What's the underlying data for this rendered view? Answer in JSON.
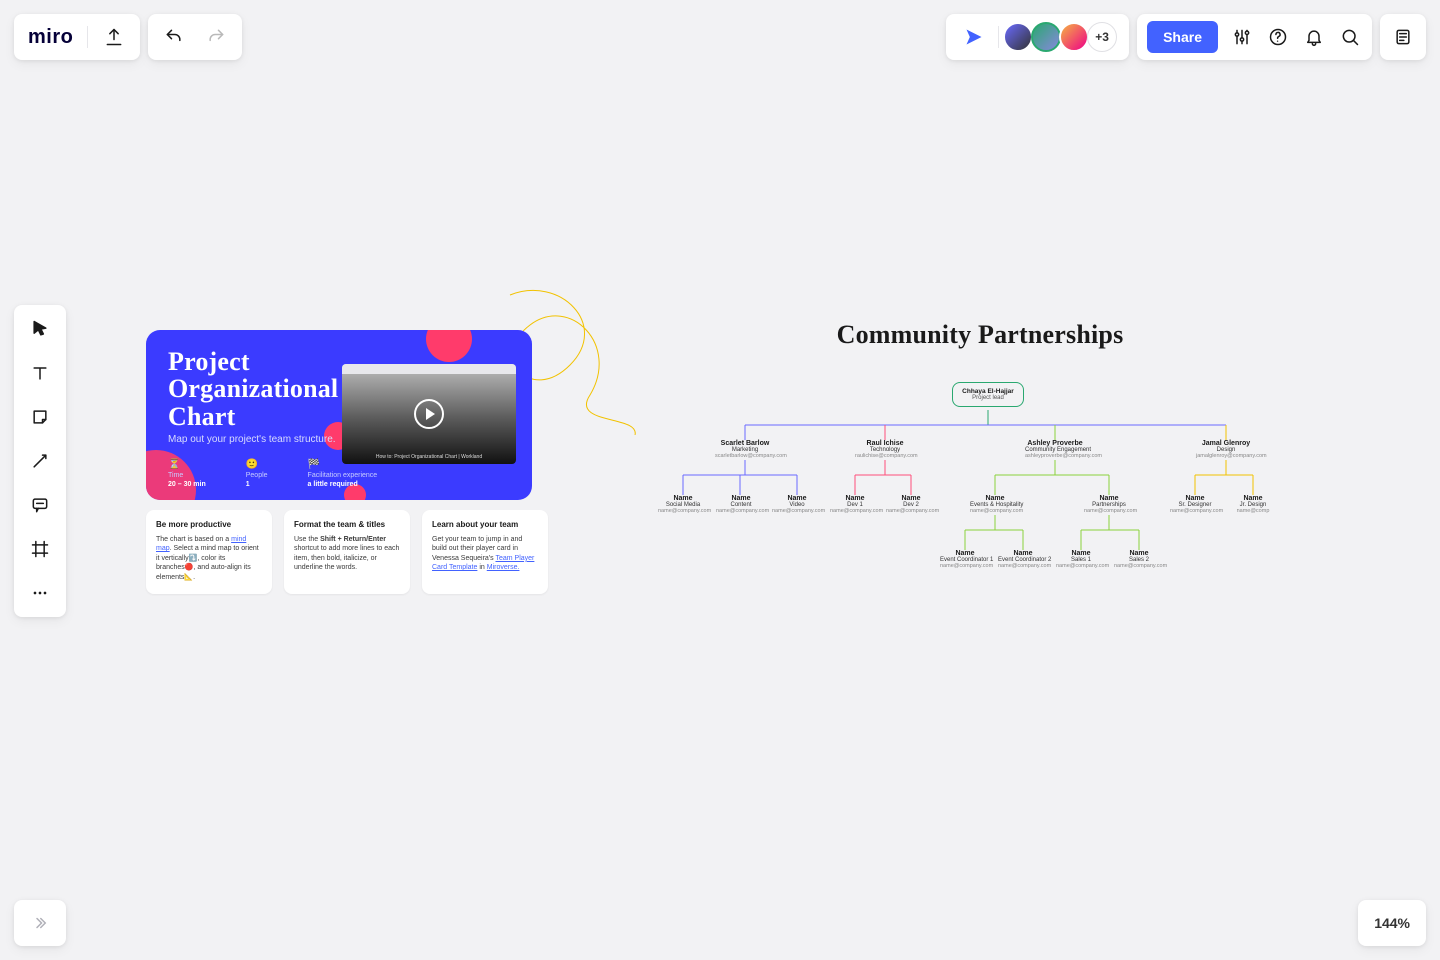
{
  "header": {
    "logo": "miro",
    "more_avatars": "+3",
    "share_label": "Share"
  },
  "zoom": "144%",
  "hero": {
    "title_l1": "Project",
    "title_l2": "Organizational",
    "title_l3": "Chart",
    "subtitle": "Map out your project's team structure.",
    "meta": {
      "time_label": "Time",
      "time_value": "20 – 30 min",
      "people_label": "People",
      "people_value": "1",
      "facil_label": "Facilitation experience",
      "facil_value": "a little required"
    },
    "video_caption": "How to: Project Organizational Chart | Workland"
  },
  "tips": [
    {
      "title": "Be more productive",
      "body_pre": "The chart is based on a ",
      "body_link": "mind map",
      "body_post": ". Select a mind map to orient it vertically⤵️, color its branches🔴, and auto-align its elements📐."
    },
    {
      "title": "Format the team & titles",
      "body_pre": "Use the ",
      "body_bold": "Shift + Return/Enter",
      "body_post": " shortcut to add more lines to each item, then bold, italicize, or underline the words."
    },
    {
      "title": "Learn about your team",
      "body_pre": "Get your team to jump in and build out their player card in Venessa Sequeira's ",
      "body_link1": "Team Player Card Template",
      "body_mid": " in ",
      "body_link2": "Miroverse.",
      "body_post": ""
    }
  ],
  "org": {
    "title": "Community Partnerships",
    "lead": {
      "name": "Chhaya El-Hajjar",
      "role": "Project lead"
    },
    "level2": [
      {
        "name": "Scarlet Barlow",
        "role": "Marketing",
        "email": "scarletbarlow@company.com"
      },
      {
        "name": "Raul Ichise",
        "role": "Technology",
        "email": "raulichise@company.com"
      },
      {
        "name": "Ashley Proverbe",
        "role": "Community Engagement",
        "email": "ashleyproverbe@company.com"
      },
      {
        "name": "Jamal Glenroy",
        "role": "Design",
        "email": "jamalglenroy@company.com"
      }
    ],
    "level3": [
      {
        "name": "Name",
        "role": "Social Media",
        "email": "name@company.com"
      },
      {
        "name": "Name",
        "role": "Content",
        "email": "name@company.com"
      },
      {
        "name": "Name",
        "role": "Video",
        "email": "name@company.com"
      },
      {
        "name": "Name",
        "role": "Dev 1",
        "email": "name@company.com"
      },
      {
        "name": "Name",
        "role": "Dev 2",
        "email": "name@company.com"
      },
      {
        "name": "Name",
        "role": "Events & Hospitality",
        "email": "name@company.com"
      },
      {
        "name": "Name",
        "role": "Partnerships",
        "email": "name@company.com"
      },
      {
        "name": "Name",
        "role": "Sr. Designer",
        "email": "name@company.com"
      },
      {
        "name": "Name",
        "role": "Jr. Design",
        "email": "name@comp"
      }
    ],
    "level4": [
      {
        "name": "Name",
        "role": "Event Coordinator 1",
        "email": "name@company.com"
      },
      {
        "name": "Name",
        "role": "Event Coordinator 2",
        "email": "name@company.com"
      },
      {
        "name": "Name",
        "role": "Sales 1",
        "email": "name@company.com"
      },
      {
        "name": "Name",
        "role": "Sales 2",
        "email": "name@company.com"
      }
    ]
  }
}
